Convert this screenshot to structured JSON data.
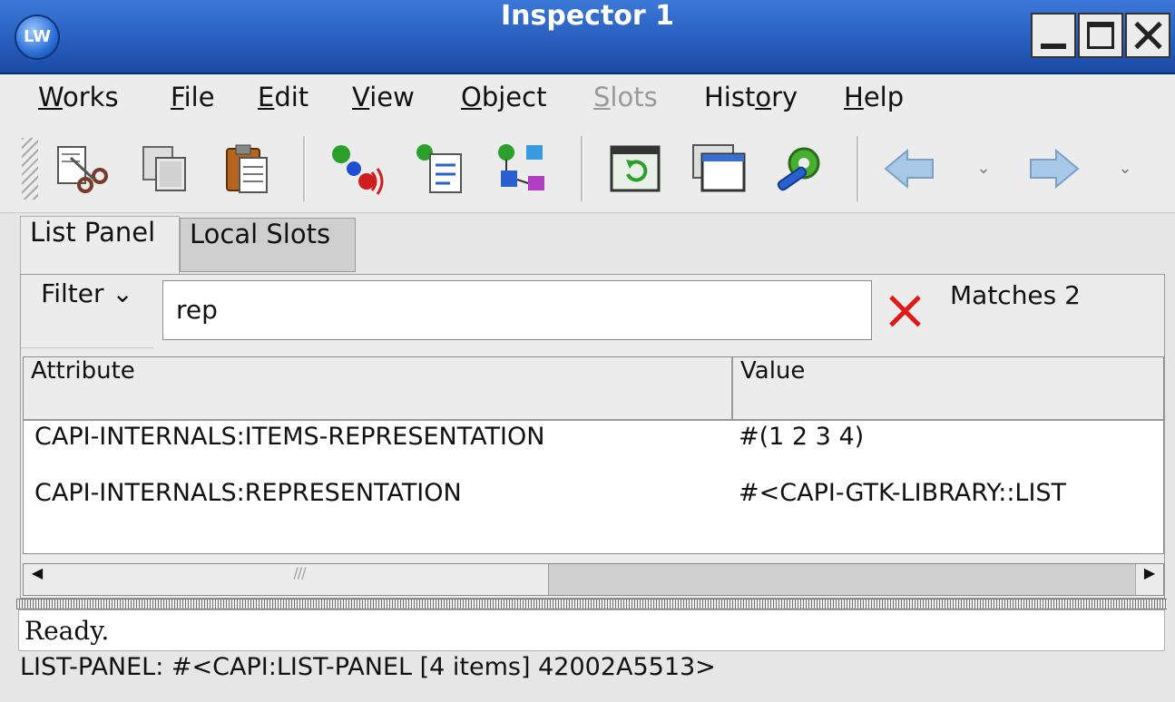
{
  "window": {
    "title": "Inspector 1",
    "app_icon_text": "LW"
  },
  "menu": {
    "items": [
      {
        "label": "Works",
        "mnemonic": "W",
        "rest": "orks"
      },
      {
        "label": "File",
        "mnemonic": "F",
        "rest": "ile"
      },
      {
        "label": "Edit",
        "mnemonic": "E",
        "rest": "dit"
      },
      {
        "label": "View",
        "mnemonic": "V",
        "rest": "iew"
      },
      {
        "label": "Object",
        "mnemonic": "O",
        "rest": "bject"
      },
      {
        "label": "Slots",
        "mnemonic": "S",
        "rest": "lots",
        "disabled": true
      },
      {
        "label": "History",
        "pre": "Hist",
        "mnemonic": "o",
        "rest": "ry"
      },
      {
        "label": "Help",
        "mnemonic": "H",
        "rest": "elp"
      }
    ]
  },
  "toolbar": {
    "buttons": [
      "cut-icon",
      "copy-icon",
      "paste-icon",
      "inspect-objects-icon",
      "browse-class-icon",
      "class-tree-icon",
      "refresh-icon",
      "clone-window-icon",
      "preferences-icon",
      "back-icon",
      "forward-icon"
    ]
  },
  "tabs": {
    "list_panel": "List Panel",
    "local_slots": "Local Slots"
  },
  "filter": {
    "label": "Filter",
    "chevron": "⌄",
    "value": "rep",
    "matches": "Matches 2"
  },
  "table": {
    "columns": {
      "attribute": "Attribute",
      "value": "Value"
    },
    "rows": [
      {
        "attribute": "CAPI-INTERNALS:ITEMS-REPRESENTATION",
        "value": "#(1 2 3 4)"
      },
      {
        "attribute": "CAPI-INTERNALS:REPRESENTATION",
        "value": "#<CAPI-GTK-LIBRARY::LIST"
      }
    ],
    "scroll_thumb_grip": "///"
  },
  "status": {
    "message": "Ready.",
    "bar": "LIST-PANEL: #<CAPI:LIST-PANEL [4 items] 42002A5513>"
  }
}
